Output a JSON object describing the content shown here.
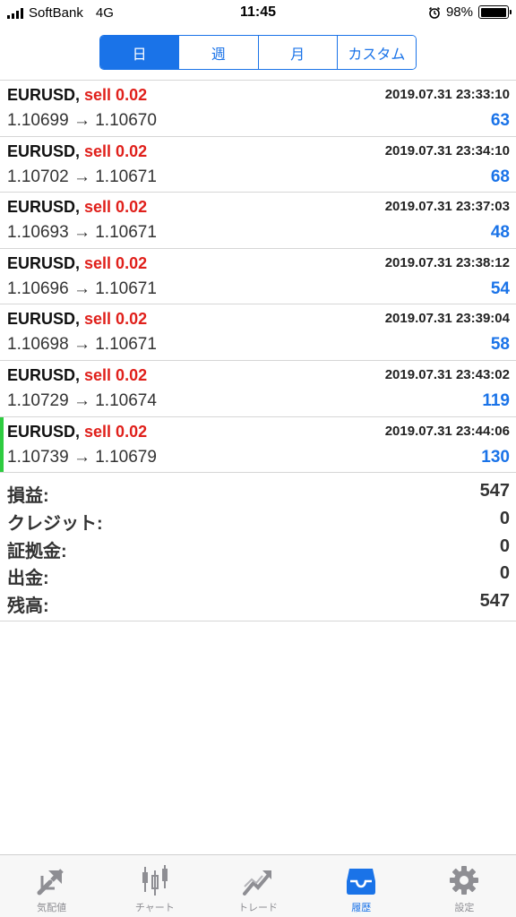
{
  "status_bar": {
    "carrier": "SoftBank",
    "network": "4G",
    "time": "11:45",
    "battery": "98%",
    "battery_level": 0.98
  },
  "period_tabs": [
    {
      "label": "日",
      "active": true
    },
    {
      "label": "週",
      "active": false
    },
    {
      "label": "月",
      "active": false
    },
    {
      "label": "カスタム",
      "active": false
    }
  ],
  "trades": [
    {
      "symbol": "EURUSD,",
      "type": "sell 0.02",
      "time": "2019.07.31 23:33:10",
      "prices": "1.10699 → 1.10670",
      "profit": "63"
    },
    {
      "symbol": "EURUSD,",
      "type": "sell 0.02",
      "time": "2019.07.31 23:34:10",
      "prices": "1.10702 → 1.10671",
      "profit": "68"
    },
    {
      "symbol": "EURUSD,",
      "type": "sell 0.02",
      "time": "2019.07.31 23:37:03",
      "prices": "1.10693 → 1.10671",
      "profit": "48"
    },
    {
      "symbol": "EURUSD,",
      "type": "sell 0.02",
      "time": "2019.07.31 23:38:12",
      "prices": "1.10696 → 1.10671",
      "profit": "54"
    },
    {
      "symbol": "EURUSD,",
      "type": "sell 0.02",
      "time": "2019.07.31 23:39:04",
      "prices": "1.10698 → 1.10671",
      "profit": "58"
    },
    {
      "symbol": "EURUSD,",
      "type": "sell 0.02",
      "time": "2019.07.31 23:43:02",
      "prices": "1.10729 → 1.10674",
      "profit": "119"
    },
    {
      "symbol": "EURUSD,",
      "type": "sell 0.02",
      "time": "2019.07.31 23:44:06",
      "prices": "1.10739 → 1.10679",
      "profit": "130"
    }
  ],
  "summary": {
    "profit_label": "損益:",
    "profit_value": "547",
    "credit_label": "クレジット:",
    "credit_value": "0",
    "margin_label": "証拠金:",
    "margin_value": "0",
    "withdrawal_label": "出金:",
    "withdrawal_value": "0",
    "balance_label": "残高:",
    "balance_value": "547"
  },
  "tabbar": [
    {
      "label": "気配値",
      "icon": "quotes-icon"
    },
    {
      "label": "チャート",
      "icon": "chart-icon"
    },
    {
      "label": "トレード",
      "icon": "trade-icon"
    },
    {
      "label": "履歴",
      "icon": "history-icon",
      "active": true
    },
    {
      "label": "設定",
      "icon": "settings-icon"
    }
  ],
  "colors": {
    "accent": "#1a73e8",
    "sell": "#e0201b",
    "highlight": "#2ecc40"
  }
}
